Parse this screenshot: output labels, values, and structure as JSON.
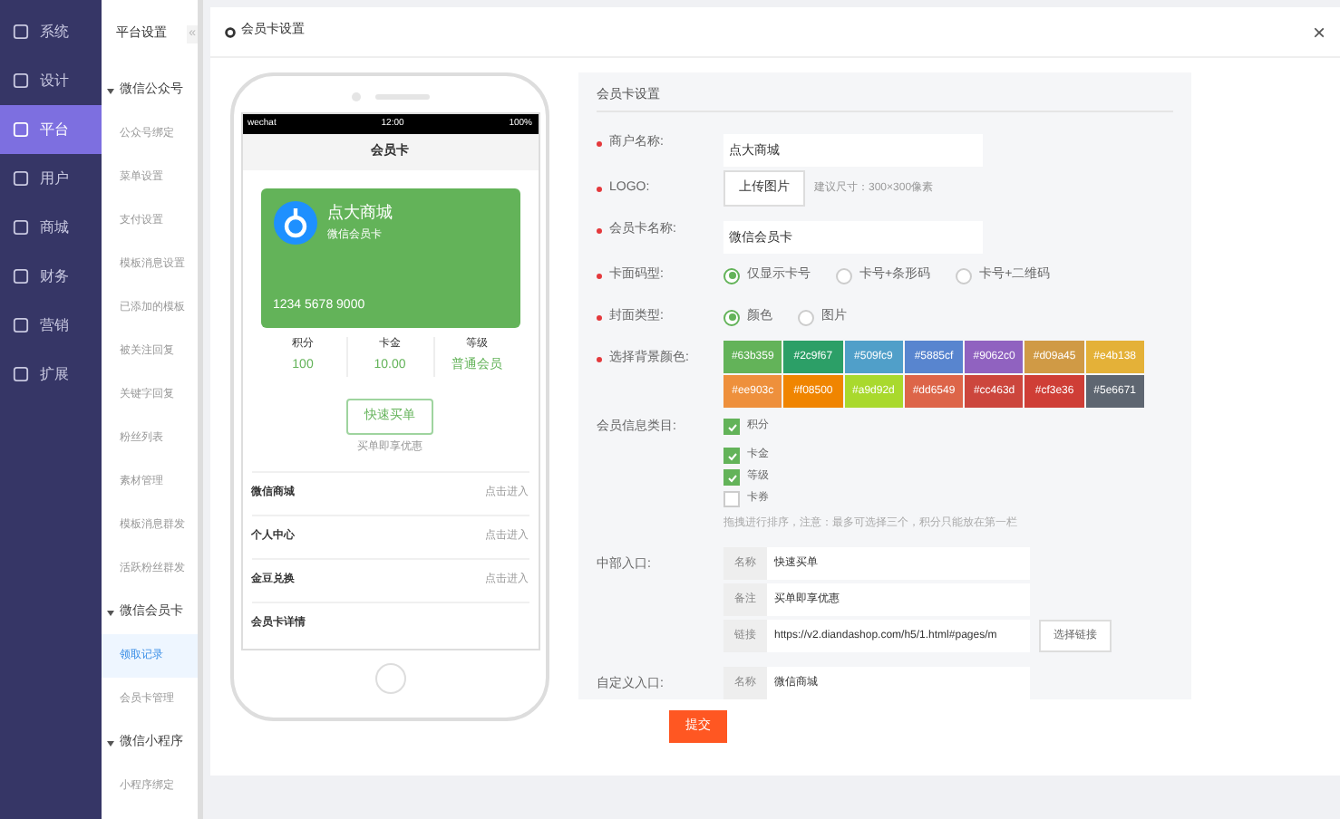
{
  "main_nav": [
    {
      "label": "系统",
      "selected": false
    },
    {
      "label": "设计",
      "selected": false
    },
    {
      "label": "平台",
      "selected": true
    },
    {
      "label": "用户",
      "selected": false
    },
    {
      "label": "商城",
      "selected": false
    },
    {
      "label": "财务",
      "selected": false
    },
    {
      "label": "营销",
      "selected": false
    },
    {
      "label": "扩展",
      "selected": false
    }
  ],
  "sub_nav": {
    "title": "平台设置",
    "collapse": "«",
    "groups": [
      {
        "label": "微信公众号",
        "items": [
          {
            "label": "公众号绑定",
            "selected": false
          },
          {
            "label": "菜单设置",
            "selected": false
          },
          {
            "label": "支付设置",
            "selected": false
          },
          {
            "label": "模板消息设置",
            "selected": false
          },
          {
            "label": "已添加的模板",
            "selected": false
          },
          {
            "label": "被关注回复",
            "selected": false
          },
          {
            "label": "关键字回复",
            "selected": false
          },
          {
            "label": "粉丝列表",
            "selected": false
          },
          {
            "label": "素材管理",
            "selected": false
          },
          {
            "label": "模板消息群发",
            "selected": false
          },
          {
            "label": "活跃粉丝群发",
            "selected": false
          }
        ]
      },
      {
        "label": "微信会员卡",
        "items": [
          {
            "label": "领取记录",
            "selected": true
          },
          {
            "label": "会员卡管理",
            "selected": false
          }
        ]
      },
      {
        "label": "微信小程序",
        "items": [
          {
            "label": "小程序绑定",
            "selected": false
          }
        ]
      }
    ]
  },
  "page_title": "会员卡设置",
  "close": "×",
  "phone": {
    "carrier": "wechat",
    "time": "12:00",
    "battery": "100%",
    "title": "会员卡",
    "card": {
      "shop": "点大商城",
      "name": "微信会员卡",
      "number": "1234 5678 9000"
    },
    "stats": [
      {
        "label": "积分",
        "value": "100"
      },
      {
        "label": "卡金",
        "value": "10.00"
      },
      {
        "label": "等级",
        "value": "普通会员"
      }
    ],
    "button": "快速买单",
    "button_note": "买单即享优惠",
    "links": [
      {
        "label": "微信商城",
        "action": "点击进入"
      },
      {
        "label": "个人中心",
        "action": "点击进入"
      },
      {
        "label": "金豆兑换",
        "action": "点击进入"
      },
      {
        "label": "会员卡详情"
      }
    ]
  },
  "form": {
    "title": "会员卡设置",
    "merchant": {
      "label": "商户名称:",
      "value": "点大商城"
    },
    "logo": {
      "label": "LOGO:",
      "button": "上传图片",
      "hint": "建议尺寸：300×300像素"
    },
    "card_name": {
      "label": "会员卡名称:",
      "value": "微信会员卡"
    },
    "code_type": {
      "label": "卡面码型:",
      "options": [
        {
          "label": "仅显示卡号",
          "selected": true
        },
        {
          "label": "卡号+条形码",
          "selected": false
        },
        {
          "label": "卡号+二维码",
          "selected": false
        }
      ]
    },
    "cover_type": {
      "label": "封面类型:",
      "options": [
        {
          "label": "颜色",
          "selected": true
        },
        {
          "label": "图片",
          "selected": false
        }
      ]
    },
    "bg_color": {
      "label": "选择背景颜色:",
      "colors": [
        {
          "label": "#63b359",
          "color": "#63b359"
        },
        {
          "label": "#2c9f67",
          "color": "#2c9f67"
        },
        {
          "label": "#509fc9",
          "color": "#509fc9"
        },
        {
          "label": "#5885cf",
          "color": "#5885cf"
        },
        {
          "label": "#9062c0",
          "color": "#9062c0"
        },
        {
          "label": "#d09a45",
          "color": "#d09a45"
        },
        {
          "label": "#e4b138",
          "color": "#e4b138"
        },
        {
          "label": "#ee903c",
          "color": "#ee903c"
        },
        {
          "label": "#f08500",
          "color": "#f08500"
        },
        {
          "label": "#a9d92d",
          "color": "#a9d92d"
        },
        {
          "label": "#dd6549",
          "color": "#dd6549"
        },
        {
          "label": "#cc463d",
          "color": "#cc463d"
        },
        {
          "label": "#cf3e36",
          "color": "#cf3e36"
        },
        {
          "label": "#5e6671",
          "color": "#5e6671"
        }
      ]
    },
    "info_items": {
      "label": "会员信息类目:",
      "items": [
        {
          "label": "积分",
          "checked": true
        },
        {
          "label": "卡金",
          "checked": true
        },
        {
          "label": "等级",
          "checked": true
        },
        {
          "label": "卡券",
          "checked": false
        }
      ],
      "hint": "拖拽进行排序，注意：最多可选择三个，积分只能放在第一栏"
    },
    "middle_entry": {
      "label": "中部入口:",
      "fields": [
        {
          "label": "名称",
          "value": "快速买单"
        },
        {
          "label": "备注",
          "value": "买单即享优惠"
        },
        {
          "label": "链接",
          "value": "https://v2.diandashop.com/h5/1.html#pages/m",
          "button": "选择链接"
        }
      ]
    },
    "custom_entry": {
      "label": "自定义入口:",
      "fields": [
        {
          "label": "名称",
          "value": "微信商城"
        }
      ]
    },
    "submit": "提交"
  }
}
